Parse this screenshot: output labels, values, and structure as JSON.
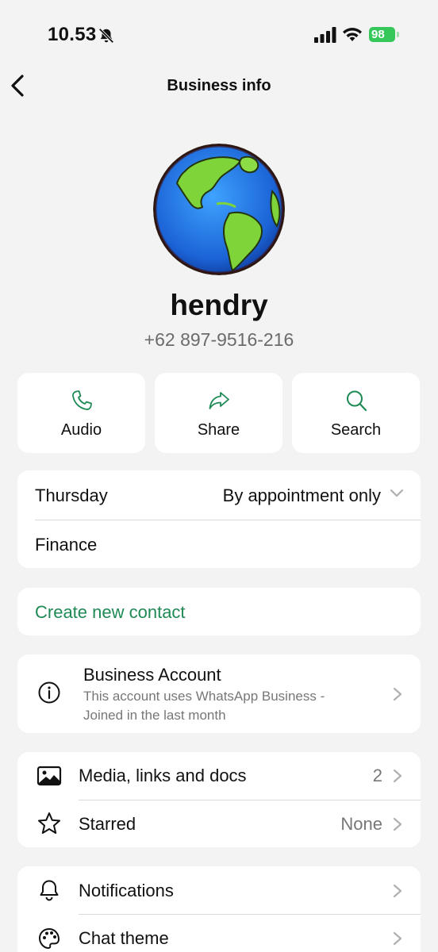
{
  "status_bar": {
    "time": "10.53",
    "battery": "98"
  },
  "nav": {
    "title": "Business info"
  },
  "profile": {
    "name": "hendry",
    "phone": "+62 897-9516-216"
  },
  "actions": [
    {
      "label": "Audio",
      "icon": "phone-icon"
    },
    {
      "label": "Share",
      "icon": "share-icon"
    },
    {
      "label": "Search",
      "icon": "search-icon"
    }
  ],
  "hours": {
    "day": "Thursday",
    "value": "By appointment only",
    "category": "Finance"
  },
  "create_contact": "Create new contact",
  "business_account": {
    "title": "Business Account",
    "line1": "This account uses WhatsApp Business -",
    "line2": "Joined in the last month"
  },
  "media": {
    "media_label": "Media, links and docs",
    "media_count": "2",
    "starred_label": "Starred",
    "starred_value": "None"
  },
  "settings": {
    "notifications_label": "Notifications",
    "chat_theme_label": "Chat theme"
  },
  "colors": {
    "accent": "#1f8a55",
    "background": "#f3f3f3",
    "battery": "#35c759"
  }
}
